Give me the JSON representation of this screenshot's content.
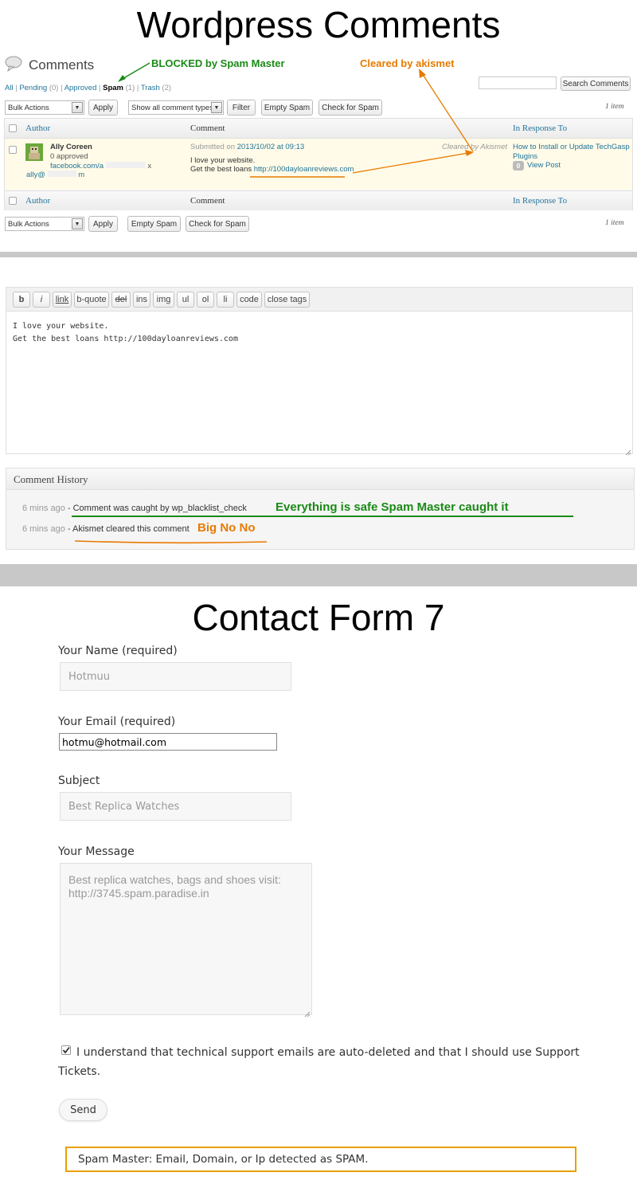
{
  "wp": {
    "title": "Wordpress Comments",
    "page_heading": "Comments",
    "filters": [
      {
        "label": "All",
        "count": ""
      },
      {
        "label": "Pending",
        "count": "(0)"
      },
      {
        "label": "Approved",
        "count": ""
      },
      {
        "label": "Spam",
        "count": "(1)"
      },
      {
        "label": "Trash",
        "count": "(2)"
      }
    ],
    "search_button": "Search Comments",
    "bulk_actions": "Bulk Actions",
    "apply": "Apply",
    "comment_type_filter": "Show all comment types",
    "filter_button": "Filter",
    "empty_spam": "Empty Spam",
    "check_spam": "Check for Spam",
    "item_count": "1 item",
    "columns": {
      "author": "Author",
      "comment": "Comment",
      "response": "In Response To"
    },
    "row": {
      "author_name": "Ally Coreen",
      "approved": "0 approved",
      "url": "facebook.com/a",
      "url_end": "x",
      "email_start": "ally@",
      "email_end": "m",
      "submitted_prefix": "Submitted on",
      "submitted_date": "2013/10/02 at 09:13",
      "status_note": "Cleared by Akismet",
      "comment_line1": "I love your website.",
      "comment_line2_prefix": "Get the best loans",
      "comment_link": "http://100dayloanreviews.com",
      "post_title_line1": "How to Install or Update TechGasp",
      "post_title_line2": "Plugins",
      "comment_bubble": "0",
      "view_post": "View Post"
    },
    "annotations": {
      "blocked": "BLOCKED by Spam Master",
      "cleared": "Cleared by akismet"
    }
  },
  "editor": {
    "buttons": [
      "b",
      "i",
      "link",
      "b-quote",
      "del",
      "ins",
      "img",
      "ul",
      "ol",
      "li",
      "code",
      "close tags"
    ],
    "text_line1": "I love your website.",
    "text_line2": "Get the best loans http://100dayloanreviews.com"
  },
  "history": {
    "heading": "Comment History",
    "entries": [
      {
        "time": "6 mins ago",
        "text": "Comment was caught by wp_blacklist_check",
        "note": "Everything is safe Spam Master caught it"
      },
      {
        "time": "6 mins ago",
        "text": "Akismet cleared this comment",
        "note": "Big No No"
      }
    ]
  },
  "cf7": {
    "title": "Contact Form 7",
    "name_label": "Your Name (required)",
    "name_value": "Hotmuu",
    "email_label": "Your Email (required)",
    "email_value": "hotmu@hotmail.com",
    "subject_label": "Subject",
    "subject_value": "Best Replica Watches",
    "message_label": "Your Message",
    "message_line1": "Best replica watches, bags and shoes visit:",
    "message_line2": "http://3745.spam.paradise.in",
    "checkbox_line1": "I understand that technical support emails are auto-deleted and that I should use Support",
    "checkbox_line2": "Tickets.",
    "send": "Send",
    "result": "Spam Master: Email, Domain, or Ip detected as SPAM."
  },
  "colors": {
    "accent_orange": "#e87a00",
    "accent_green": "#1b8a17",
    "wp_link": "#21759b"
  }
}
